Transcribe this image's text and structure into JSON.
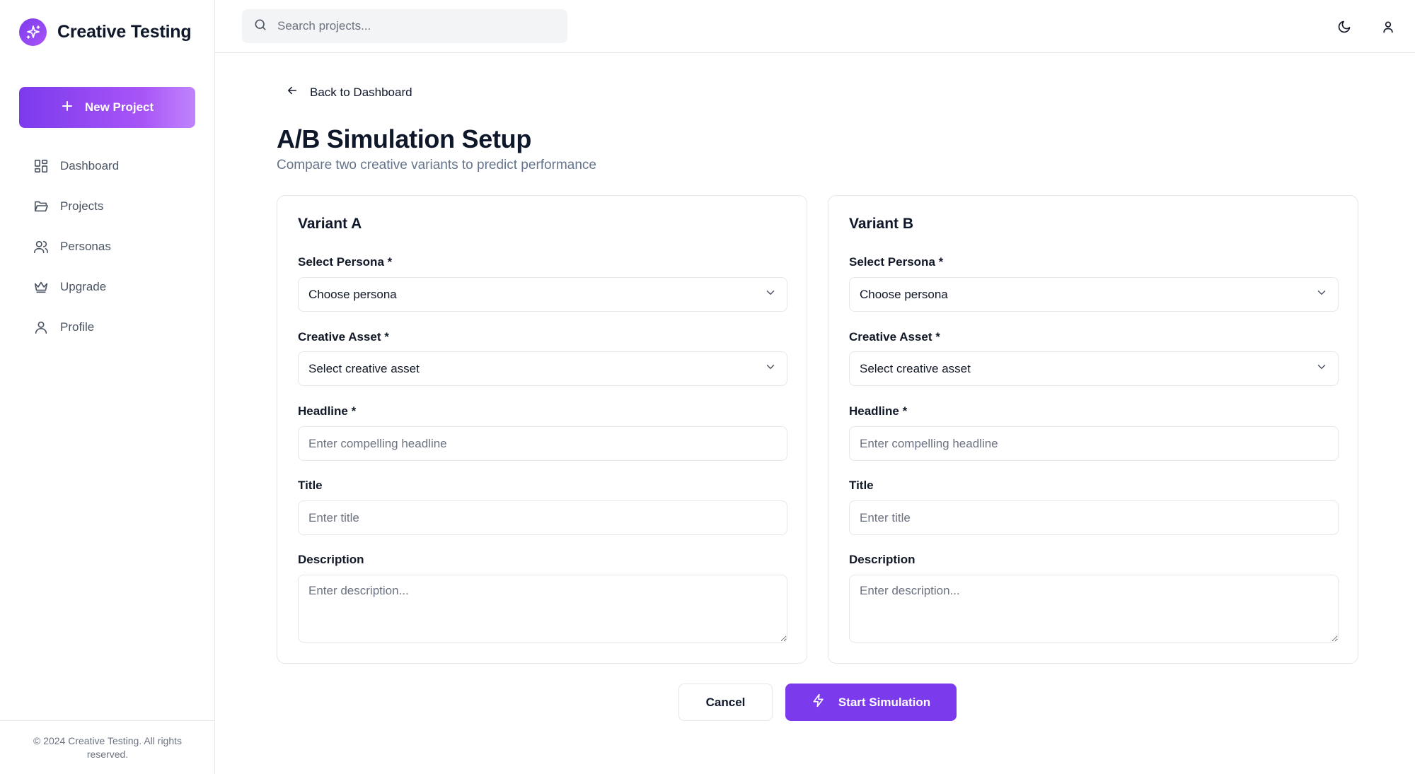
{
  "app": {
    "name": "Creative Testing",
    "accent_color": "#7c3aed",
    "logo_icon": "sparkles-icon"
  },
  "sidebar": {
    "new_project_label": "New Project",
    "items": [
      {
        "label": "Dashboard",
        "icon": "layout-dashboard-icon"
      },
      {
        "label": "Projects",
        "icon": "folder-open-icon"
      },
      {
        "label": "Personas",
        "icon": "users-icon"
      },
      {
        "label": "Upgrade",
        "icon": "crown-icon"
      },
      {
        "label": "Profile",
        "icon": "user-icon"
      }
    ],
    "footer": "© 2024 Creative Testing. All rights reserved."
  },
  "topbar": {
    "search_placeholder": "Search projects...",
    "icons": [
      "moon-icon",
      "user-icon"
    ]
  },
  "main": {
    "back_label": "Back to Dashboard",
    "title": "A/B Simulation Setup",
    "subtitle": "Compare two creative variants to predict performance",
    "variants": [
      {
        "title": "Variant A",
        "persona_label": "Select Persona *",
        "persona_value": "Choose persona",
        "asset_label": "Creative Asset *",
        "asset_value": "Select creative asset",
        "headline_label": "Headline *",
        "headline_placeholder": "Enter compelling headline",
        "title_label": "Title",
        "title_placeholder": "Enter title",
        "description_label": "Description",
        "description_placeholder": "Enter description..."
      },
      {
        "title": "Variant B",
        "persona_label": "Select Persona *",
        "persona_value": "Choose persona",
        "asset_label": "Creative Asset *",
        "asset_value": "Select creative asset",
        "headline_label": "Headline *",
        "headline_placeholder": "Enter compelling headline",
        "title_label": "Title",
        "title_placeholder": "Enter title",
        "description_label": "Description",
        "description_placeholder": "Enter description..."
      }
    ],
    "cancel_label": "Cancel",
    "start_label": "Start Simulation"
  }
}
